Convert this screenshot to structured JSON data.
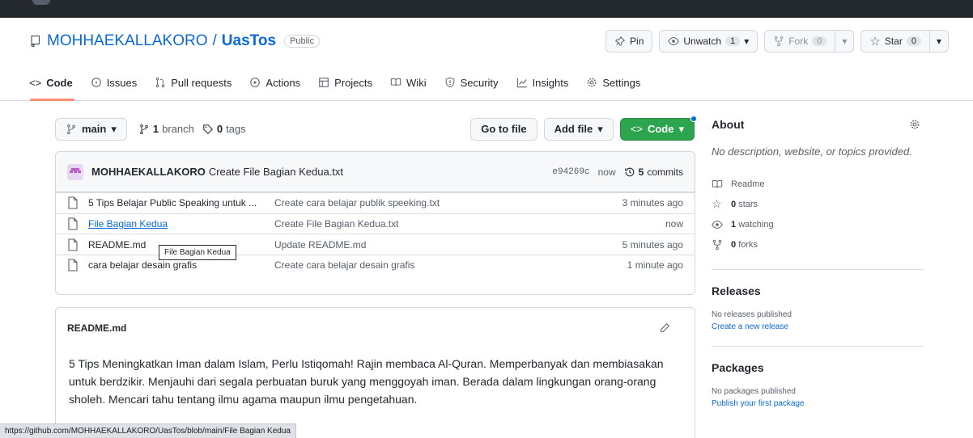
{
  "repo": {
    "owner": "MOHHAEKALLAKORO",
    "separator": "/",
    "name": "UasTos",
    "visibility": "Public"
  },
  "header_buttons": {
    "pin": "Pin",
    "unwatch": "Unwatch",
    "unwatch_count": "1",
    "fork": "Fork",
    "fork_count": "0",
    "star": "Star",
    "star_count": "0"
  },
  "tabs": [
    {
      "label": "Code",
      "icon": "code-icon",
      "selected": true
    },
    {
      "label": "Issues",
      "icon": "issues-icon"
    },
    {
      "label": "Pull requests",
      "icon": "pull-request-icon"
    },
    {
      "label": "Actions",
      "icon": "play-icon"
    },
    {
      "label": "Projects",
      "icon": "table-icon"
    },
    {
      "label": "Wiki",
      "icon": "book-icon"
    },
    {
      "label": "Security",
      "icon": "shield-icon"
    },
    {
      "label": "Insights",
      "icon": "graph-icon"
    },
    {
      "label": "Settings",
      "icon": "gear-icon"
    }
  ],
  "toolbar": {
    "branch": "main",
    "branch_count": "1",
    "branch_label": "branch",
    "tag_count": "0",
    "tag_label": "tags",
    "go_to_file": "Go to file",
    "add_file": "Add file",
    "code": "Code"
  },
  "commit": {
    "author": "MOHHAEKALLAKORO",
    "message": "Create File Bagian Kedua.txt",
    "sha": "e94269c",
    "when": "now",
    "count": "5",
    "count_label": "commits"
  },
  "files": [
    {
      "name": "5 Tips Belajar Public Speaking untuk ...",
      "message": "Create cara belajar publik speeking.txt",
      "age": "3 minutes ago"
    },
    {
      "name": "File Bagian Kedua",
      "message": "Create File Bagian Kedua.txt",
      "age": "now",
      "hovered": true
    },
    {
      "name": "README.md",
      "message": "Update README.md",
      "age": "5 minutes ago"
    },
    {
      "name": "cara belajar desain grafis",
      "message": "Create cara belajar desain grafis",
      "age": "1 minute ago"
    }
  ],
  "tooltip": "File Bagian Kedua",
  "readme": {
    "title": "README.md",
    "body": "5 Tips Meningkatkan Iman dalam Islam, Perlu Istiqomah! Rajin membaca Al-Quran. Memperbanyak dan membiasakan untuk berdzikir. Menjauhi dari segala perbuatan buruk yang menggoyah iman. Berada dalam lingkungan orang-orang sholeh. Mencari tahu tentang ilmu agama maupun ilmu pengetahuan."
  },
  "about": {
    "title": "About",
    "description": "No description, website, or topics provided.",
    "readme": "Readme",
    "stars_count": "0",
    "stars_label": "stars",
    "watching_count": "1",
    "watching_label": "watching",
    "forks_count": "0",
    "forks_label": "forks"
  },
  "releases": {
    "title": "Releases",
    "empty": "No releases published",
    "link": "Create a new release"
  },
  "packages": {
    "title": "Packages",
    "empty": "No packages published",
    "link": "Publish your first package"
  },
  "status_url": "https://github.com/MOHHAEKALLAKORO/UasTos/blob/main/File Bagian Kedua",
  "colors": {
    "accent": "#0969da",
    "green": "#2da44e",
    "tab_underline": "#fd8c73"
  }
}
